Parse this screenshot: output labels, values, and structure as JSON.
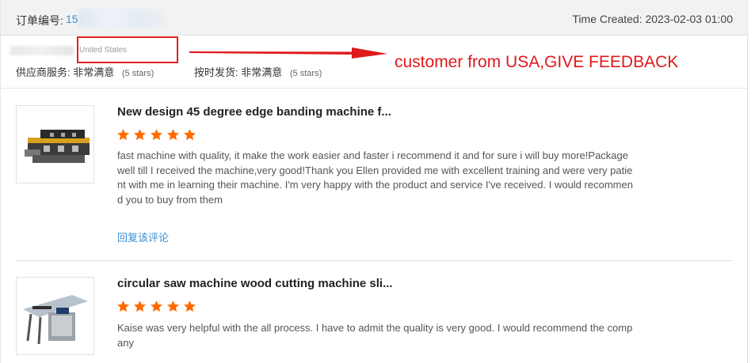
{
  "header": {
    "order_label": "订单编号:",
    "order_number_visible": "15",
    "time_created": "Time Created: 2023-02-03 01:00"
  },
  "buyer": {
    "country": "United States",
    "service_label": "供应商服务:",
    "service_value": "非常满意",
    "service_stars": "(5 stars)",
    "shipping_label": "按时发货:",
    "shipping_value": "非常满意",
    "shipping_stars": "(5 stars)"
  },
  "annotation": {
    "text": "customer from USA,GIVE FEEDBACK",
    "color": "#e0191c"
  },
  "reviews": [
    {
      "title": "New design 45 degree edge banding machine f...",
      "rating": 5,
      "text": "fast machine with quality, it make the work easier and faster i recommend it and for sure i will buy more!Package well till I received the machine,very good!Thank you Ellen provided me with excellent training and were very patient with me in learning their machine. I'm very happy with the product and service I've received. I would recommend you to buy from them",
      "reply_label": "回复该评论"
    },
    {
      "title": "circular saw machine wood cutting machine sli...",
      "rating": 5,
      "text": "Kaise was very helpful with the all process. I have to admit the quality is very good. I would recommend the company"
    }
  ],
  "colors": {
    "star": "#ff6a00",
    "link": "#3b8fd6",
    "highlight_box": "#e02020"
  }
}
